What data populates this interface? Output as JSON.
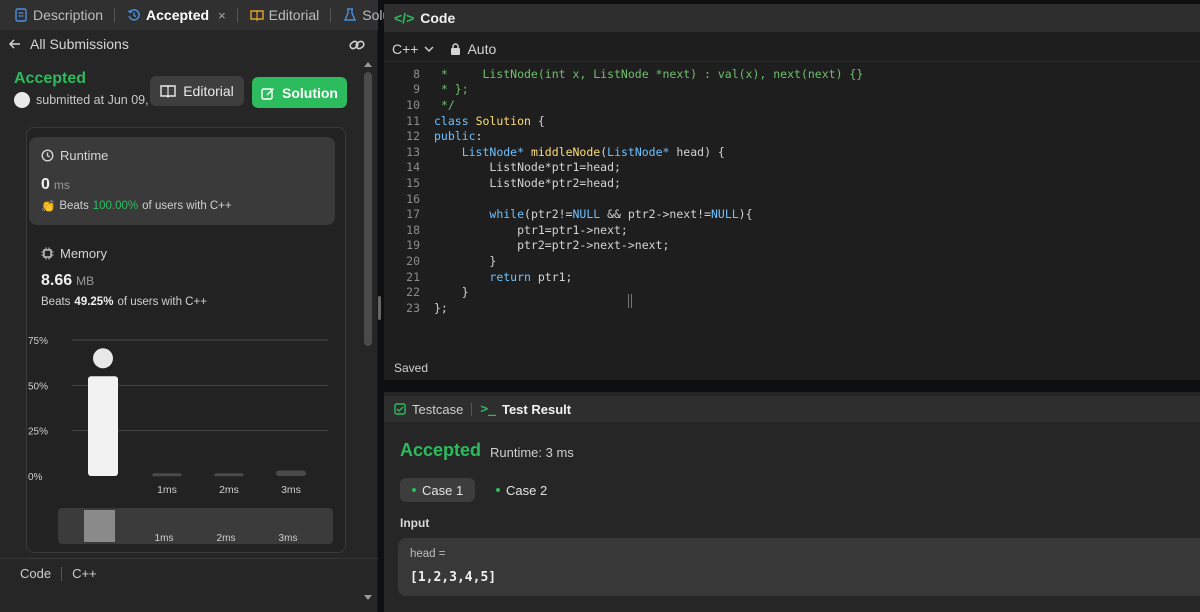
{
  "tabs": [
    {
      "label": "Description"
    },
    {
      "label": "Accepted",
      "close": "×"
    },
    {
      "label": "Editorial"
    },
    {
      "label": "Solutions"
    }
  ],
  "nav": {
    "all_submissions": "All Submissions"
  },
  "submission": {
    "status": "Accepted",
    "submitted_text": "submitted at Jun 09,",
    "editorial_btn": "Editorial",
    "solution_btn": "Solution"
  },
  "runtime": {
    "title": "Runtime",
    "value": "0",
    "unit": "ms",
    "beats_prefix": "Beats",
    "beats_pct": "100.00%",
    "beats_suffix": "of users with C++"
  },
  "memory": {
    "title": "Memory",
    "value": "8.66",
    "unit": "MB",
    "beats_prefix": "Beats",
    "beats_pct": "49.25%",
    "beats_suffix": "of users with C++"
  },
  "chart_data": {
    "type": "bar",
    "categories": [
      "",
      "1ms",
      "2ms",
      "3ms"
    ],
    "values": [
      55,
      1.5,
      1.5,
      3
    ],
    "yticks": [
      "75%",
      "50%",
      "25%",
      "0%"
    ],
    "ylim": [
      0,
      75
    ],
    "highlight_index": 0,
    "minimap_labels": [
      "1ms",
      "2ms",
      "3ms"
    ]
  },
  "footer": {
    "label": "Code",
    "lang": "C++"
  },
  "editor": {
    "title": "Code",
    "language": "C++",
    "mode": "Auto",
    "saved": "Saved",
    "lines": [
      {
        "n": "8",
        "html": "<span class=\"cm\"> *     ListNode(int x, ListNode *next) : val(x), next(next) {}</span>"
      },
      {
        "n": "9",
        "html": "<span class=\"cm\"> * };</span>"
      },
      {
        "n": "10",
        "html": "<span class=\"cm\"> */</span>"
      },
      {
        "n": "11",
        "html": "<span class=\"kw\">class</span> <span class=\"fn\">Solution</span> {"
      },
      {
        "n": "12",
        "html": "<span class=\"kw\">public</span>:"
      },
      {
        "n": "13",
        "html": "    <span class=\"ty\">ListNode*</span> <span class=\"fn\">middleNode</span>(<span class=\"ty\">ListNode*</span> head) {"
      },
      {
        "n": "14",
        "html": "        ListNode*ptr1=head;"
      },
      {
        "n": "15",
        "html": "        ListNode*ptr2=head;"
      },
      {
        "n": "16",
        "html": ""
      },
      {
        "n": "17",
        "html": "        <span class=\"kw\">while</span>(ptr2!=<span class=\"nl\">NULL</span> &amp;&amp; ptr2-&gt;next!=<span class=\"nl\">NULL</span>){"
      },
      {
        "n": "18",
        "html": "            ptr1=ptr1-&gt;next;"
      },
      {
        "n": "19",
        "html": "            ptr2=ptr2-&gt;next-&gt;next;"
      },
      {
        "n": "20",
        "html": "        }"
      },
      {
        "n": "21",
        "html": "        <span class=\"kw\">return</span> ptr1;"
      },
      {
        "n": "22",
        "html": "    }"
      },
      {
        "n": "23",
        "html": "};"
      }
    ]
  },
  "test": {
    "tab_testcase": "Testcase",
    "tab_result": "Test Result",
    "status": "Accepted",
    "runtime": "Runtime: 3 ms",
    "case1": "Case 1",
    "case2": "Case 2",
    "input_label": "Input",
    "var_name": "head =",
    "var_value": "[1,2,3,4,5]"
  },
  "colors": {
    "accent": "#2cbb5d",
    "bar": "#f2f2f2",
    "bar_muted": "#4a4a4a",
    "grid": "#4a4a4a"
  }
}
